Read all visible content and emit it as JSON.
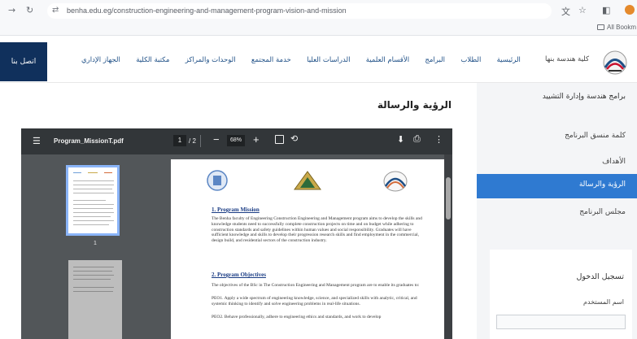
{
  "browser": {
    "url": "benha.edu.eg/construction-engineering-and-management-program-vision-and-mission",
    "bookmarks_label": "All Bookm"
  },
  "site": {
    "logo_text": "كلية هندسة بنها",
    "contact_button": "اتصل بنا",
    "nav": [
      "الرئيسية",
      "الطلاب",
      "البرامج",
      "الأقسام العلمية",
      "الدراسات العليا",
      "خدمة المجتمع",
      "الوحدات والمراكز",
      "مكتبة الكلية",
      "الجهاز الإداري"
    ]
  },
  "main": {
    "page_title": "الرؤية والرسالة"
  },
  "pdf": {
    "filename": "Program_MissionT.pdf",
    "current_page": "1",
    "total_pages": "/ 2",
    "zoom": "68%",
    "thumb_number": "1",
    "doc": {
      "section1_heading": "1. Program Mission",
      "section1_text": "The Benha faculty of Engineering Construction Engineering and Management program aims to develop the skills and knowledge students need to successfully complete construction projects on time and on budget while adhering to construction standards and safety guidelines within human values and social responsibility. Graduates will have sufficient knowledge and skills to develop their progression research skills and find employment in the commercial, design build, and residential sectors of the construction industry.",
      "section2_heading": "2. Program Objectives",
      "section2_intro": "The objectives of the BSc in The Construction Engineering and Management program are to enable its graduates to:",
      "peo1": "PEO1. Apply a wide spectrum of engineering knowledge, science, and specialized skills with analytic, critical, and systemic thinking to identify and solve engineering problems in real-life situations.",
      "peo2": "PEO2. Behave professionally, adhere to engineering ethics and standards, and work to develop"
    }
  },
  "sidebar": {
    "group_title": "برامج هندسة وإدارة التشييد",
    "items": [
      "كلمة منسق البرنامج",
      "الأهداف",
      "الرؤية والرسالة",
      "مجلس البرنامج"
    ],
    "login_title": "تسجيل الدخول",
    "username_label": "اسم المستخدم"
  },
  "colors": {
    "navy": "#10305c",
    "nav_text": "#1e4f86",
    "active_blue": "#2f7ad1"
  }
}
